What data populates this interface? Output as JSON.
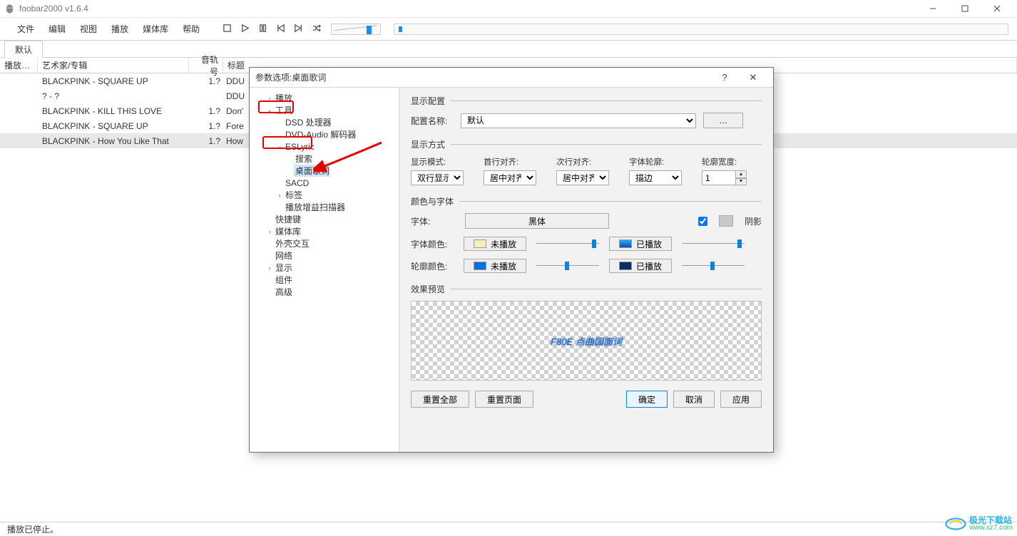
{
  "window": {
    "title": "foobar2000 v1.6.4"
  },
  "menu": {
    "items": [
      "文件",
      "编辑",
      "视图",
      "播放",
      "媒体库",
      "帮助"
    ]
  },
  "tabs": {
    "default": "默认"
  },
  "grid": {
    "headers": {
      "play": "播放…",
      "artist": "艺术家/专辑",
      "track": "音轨号",
      "title": "标题"
    },
    "rows": [
      {
        "artist": "BLACKPINK - SQUARE UP",
        "trk": "1.?",
        "title": "DDU"
      },
      {
        "artist": "? - ?",
        "trk": "",
        "title": "DDU"
      },
      {
        "artist": "BLACKPINK - KILL THIS LOVE",
        "trk": "1.?",
        "title": "Don'"
      },
      {
        "artist": "BLACKPINK - SQUARE UP",
        "trk": "1.?",
        "title": "Fore"
      },
      {
        "artist": "BLACKPINK - How You Like That",
        "trk": "1.?",
        "title": "How"
      }
    ]
  },
  "status": {
    "text": "播放已停止。"
  },
  "dialog": {
    "title": "参数选项:桌面歌词",
    "tree": {
      "n_play": "播放",
      "n_tools": "工具",
      "n_dsd": "DSD 处理器",
      "n_dvd": "DVD-Audio 解码器",
      "n_eslyric": "ESLyric",
      "n_search": "搜索",
      "n_desk": "桌面歌词",
      "n_sacd": "SACD",
      "n_tag": "标签",
      "n_gain": "播放增益扫描器",
      "n_hotkey": "快捷键",
      "n_media": "媒体库",
      "n_shell": "外壳交互",
      "n_network": "网络",
      "n_display": "显示",
      "n_component": "组件",
      "n_advanced": "高级"
    },
    "cfg": {
      "section_display": "显示配置",
      "label_cfgname": "配置名称:",
      "cfg_value": "默认",
      "more": "…",
      "section_mode": "显示方式",
      "label_mode": "显示模式:",
      "label_first": "首行对齐:",
      "label_next": "次行对齐:",
      "label_outline": "字体轮廓:",
      "label_owidth": "轮廓宽度:",
      "val_mode": "双行显示",
      "val_first": "居中对齐",
      "val_next": "居中对齐",
      "val_outline": "描边",
      "val_owidth": "1",
      "section_color": "颜色与字体",
      "label_font": "字体:",
      "font_btn": "黑体",
      "label_shadow": "阴影",
      "label_fontcolor": "字体颜色:",
      "label_outcolor": "轮廓颜色:",
      "unplayed": "未播放",
      "played": "已播放",
      "section_preview": "效果预览",
      "preview_text": "F80E  点曲図面词",
      "btn_resetall": "重置全部",
      "btn_resetpage": "重置页面",
      "btn_ok": "确定",
      "btn_cancel": "取消",
      "btn_apply": "应用"
    }
  },
  "watermark": {
    "line1": "极光下载站",
    "line2": "www.xz7.com"
  }
}
